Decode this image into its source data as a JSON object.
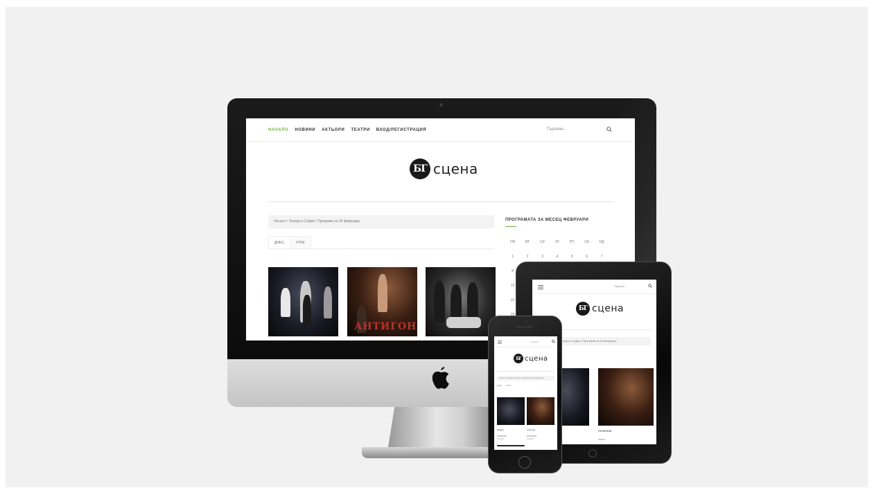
{
  "nav": {
    "items": [
      "НАЧАЛО",
      "НОВИНИ",
      "АКТЬОРИ",
      "ТЕАТРИ",
      "ВХОД/РЕГИСТРАЦИЯ"
    ],
    "active_color": "#6cb33f",
    "search_placeholder": "Търсене..."
  },
  "logo": {
    "mark": "БГ",
    "text": "сцена"
  },
  "breadcrumb": "Начало  /  Театри в София  /  Програма за 25 февруари",
  "tabs": [
    "ДНЕС",
    "УТРЕ"
  ],
  "thumbnails": [
    {
      "name": "performance-1"
    },
    {
      "name": "performance-antigona",
      "overlay_text": "АНТИГОНА"
    },
    {
      "name": "performance-3"
    }
  ],
  "calendar": {
    "title": "ПРОГРАМАТА ЗА МЕСЕЦ ФЕВРУАРИ",
    "weekdays": [
      "ПН",
      "ВТ",
      "СР",
      "ЧТ",
      "ПТ",
      "СБ",
      "НД"
    ],
    "rows": [
      [
        "1",
        "2",
        "3",
        "4",
        "5",
        "6",
        "7"
      ],
      [
        "8",
        "",
        "",
        "",
        "",
        "",
        ""
      ],
      [
        "15",
        "",
        "",
        "",
        "",
        "",
        ""
      ],
      [
        "22",
        "",
        "",
        "",
        "",
        "",
        ""
      ],
      [
        "29",
        "",
        "",
        "",
        "",
        "",
        ""
      ]
    ]
  },
  "ipad": {
    "search_placeholder": "Търсене...",
    "breadcrumb": "атри в София  /  Програма за 25 февруари",
    "caption": "Антигона"
  },
  "iphone": {
    "search_placeholder": "Търсене...",
    "breadcrumb": "Начало  /  Театри в София  /  Програма за 25 февруари",
    "tabs": [
      "ДНЕС",
      "УТРЕ"
    ],
    "captions": [
      "Бащата",
      "Антигона"
    ]
  },
  "icons": [
    "search-icon",
    "menu-icon",
    "apple-logo-icon"
  ]
}
